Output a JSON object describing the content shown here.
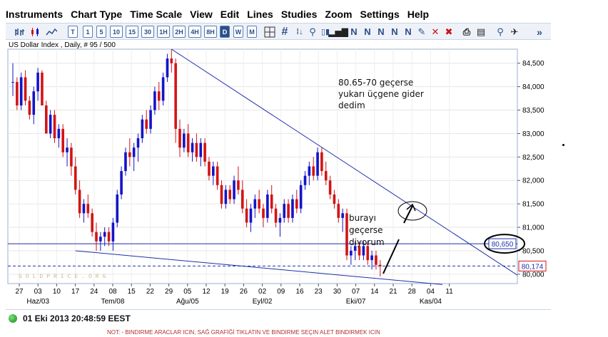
{
  "menu": [
    "Instruments",
    "Chart Type",
    "Time Scale",
    "View",
    "Edit",
    "Lines",
    "Studies",
    "Zoom",
    "Settings",
    "Help"
  ],
  "toolbar": {
    "timeframes": [
      "T",
      "1",
      "5",
      "10",
      "15",
      "30",
      "1H",
      "2H",
      "4H",
      "8H",
      "D",
      "W",
      "M"
    ],
    "active_timeframe": "D",
    "icons": [
      "bar-chart-icon",
      "candle-chart-icon",
      "line-chart-icon",
      "crosshair-icon",
      "grid-icon",
      "draw-tools-icons",
      "delete-icon",
      "print-icon",
      "zoom-icon",
      "pin-icon",
      "more-icon"
    ],
    "more_label": "»"
  },
  "chart_title": "US Dollar Index , Daily, # 95 / 500",
  "status": {
    "time": "01 Eki 2013 20:48:59 EEST"
  },
  "note": "NOT: - BINDIRME ARACLAR ICIN, SAĞ GRAFİĞİ TIKLATIN VE BINDIRME SEÇIN ALET BINDIRMEK ICIN",
  "colors": {
    "up": "#1414c8",
    "down": "#d21414",
    "trendline": "#1f2fa8",
    "accent": "#2a4f8a"
  },
  "chart_data": {
    "type": "candlestick",
    "ylim": [
      79.8,
      84.8
    ],
    "yticks": [
      "84,500",
      "84,000",
      "83,500",
      "83,000",
      "82,500",
      "82,000",
      "81,500",
      "81,000",
      "80,500",
      "80,000"
    ],
    "xticks": [
      "27",
      "03",
      "10",
      "17",
      "24",
      "08",
      "15",
      "22",
      "29",
      "05",
      "12",
      "19",
      "26",
      "02",
      "09",
      "16",
      "23",
      "30",
      "07",
      "14",
      "21",
      "28",
      "04",
      "11"
    ],
    "month_labels": [
      "Haz/03",
      "Tem/08",
      "Ağu/05",
      "Eyl/02",
      "Eki/07",
      "Kas/04"
    ],
    "horizontal_line_label": "80,650",
    "horizontal_line_value": 80.65,
    "current_price_label": "80,174",
    "current_price_value": 80.174,
    "watermark": "GOLDPRICE.ORG",
    "annotations": [
      "80.65-70 geçerse yukarı üçgene gider dedim",
      "burayı geçerse diyorum"
    ],
    "candles": [
      [
        84.1,
        84.5,
        83.8,
        84.1
      ],
      [
        84.1,
        84.2,
        83.5,
        83.6
      ],
      [
        83.6,
        84.3,
        83.5,
        84.2
      ],
      [
        84.2,
        84.35,
        83.6,
        83.7
      ],
      [
        83.7,
        83.8,
        83.3,
        83.4
      ],
      [
        83.4,
        84.0,
        83.2,
        83.9
      ],
      [
        83.9,
        84.4,
        83.7,
        84.3
      ],
      [
        84.3,
        84.35,
        83.6,
        83.6
      ],
      [
        83.6,
        83.7,
        83.0,
        83.0
      ],
      [
        83.0,
        83.5,
        82.9,
        83.4
      ],
      [
        83.4,
        83.5,
        82.8,
        82.9
      ],
      [
        82.9,
        83.2,
        82.7,
        83.1
      ],
      [
        83.1,
        83.2,
        82.5,
        82.6
      ],
      [
        82.6,
        82.9,
        82.3,
        82.7
      ],
      [
        82.7,
        82.8,
        82.1,
        82.3
      ],
      [
        82.3,
        82.5,
        81.7,
        81.8
      ],
      [
        81.8,
        82.0,
        81.2,
        81.3
      ],
      [
        81.3,
        81.6,
        81.1,
        81.5
      ],
      [
        81.5,
        81.7,
        81.2,
        81.3
      ],
      [
        81.3,
        81.4,
        80.8,
        80.9
      ],
      [
        80.9,
        81.1,
        80.5,
        80.7
      ],
      [
        80.7,
        80.9,
        80.5,
        80.8
      ],
      [
        80.8,
        81.0,
        80.6,
        80.9
      ],
      [
        80.9,
        81.0,
        80.6,
        80.7
      ],
      [
        80.7,
        81.2,
        80.5,
        81.1
      ],
      [
        81.1,
        81.8,
        81.0,
        81.7
      ],
      [
        81.7,
        82.3,
        81.6,
        82.2
      ],
      [
        82.2,
        82.7,
        82.1,
        82.6
      ],
      [
        82.6,
        82.9,
        82.3,
        82.5
      ],
      [
        82.5,
        82.8,
        82.2,
        82.7
      ],
      [
        82.7,
        83.0,
        82.4,
        82.9
      ],
      [
        82.9,
        83.4,
        82.8,
        83.3
      ],
      [
        83.3,
        83.5,
        83.0,
        83.1
      ],
      [
        83.1,
        83.6,
        83.0,
        83.5
      ],
      [
        83.5,
        84.0,
        83.4,
        83.9
      ],
      [
        83.9,
        84.1,
        83.5,
        83.7
      ],
      [
        83.7,
        84.3,
        83.6,
        84.2
      ],
      [
        84.2,
        84.7,
        84.1,
        84.6
      ],
      [
        84.6,
        84.8,
        84.3,
        84.5
      ],
      [
        84.5,
        84.6,
        82.8,
        83.1
      ],
      [
        83.1,
        83.3,
        82.5,
        82.7
      ],
      [
        82.7,
        83.1,
        82.6,
        83.0
      ],
      [
        83.0,
        83.2,
        82.5,
        82.6
      ],
      [
        82.6,
        82.9,
        82.4,
        82.8
      ],
      [
        82.8,
        83.0,
        82.4,
        82.5
      ],
      [
        82.5,
        82.9,
        82.3,
        82.8
      ],
      [
        82.8,
        82.9,
        82.3,
        82.4
      ],
      [
        82.4,
        82.5,
        82.0,
        82.1
      ],
      [
        82.1,
        82.4,
        81.9,
        82.3
      ],
      [
        82.3,
        82.4,
        81.8,
        81.9
      ],
      [
        81.9,
        82.0,
        81.4,
        81.5
      ],
      [
        81.5,
        81.9,
        81.4,
        81.8
      ],
      [
        81.8,
        81.9,
        81.5,
        81.6
      ],
      [
        81.6,
        82.1,
        81.5,
        82.0
      ],
      [
        82.0,
        82.3,
        81.7,
        81.8
      ],
      [
        81.8,
        82.0,
        81.3,
        81.4
      ],
      [
        81.4,
        81.6,
        81.0,
        81.1
      ],
      [
        81.1,
        81.5,
        80.9,
        81.4
      ],
      [
        81.4,
        81.7,
        81.2,
        81.6
      ],
      [
        81.6,
        81.8,
        81.3,
        81.4
      ],
      [
        81.4,
        81.5,
        81.0,
        81.2
      ],
      [
        81.2,
        81.8,
        81.1,
        81.7
      ],
      [
        81.7,
        81.9,
        81.3,
        81.4
      ],
      [
        81.4,
        81.5,
        81.0,
        81.1
      ],
      [
        81.1,
        81.3,
        80.8,
        81.2
      ],
      [
        81.2,
        81.6,
        81.1,
        81.5
      ],
      [
        81.5,
        81.6,
        81.1,
        81.2
      ],
      [
        81.2,
        81.7,
        81.1,
        81.6
      ],
      [
        81.6,
        81.8,
        81.3,
        81.4
      ],
      [
        81.4,
        82.0,
        81.3,
        81.9
      ],
      [
        81.9,
        82.2,
        81.8,
        82.1
      ],
      [
        82.1,
        82.4,
        81.9,
        82.3
      ],
      [
        82.3,
        82.5,
        82.0,
        82.1
      ],
      [
        82.1,
        82.7,
        82.0,
        82.6
      ],
      [
        82.6,
        82.7,
        82.1,
        82.2
      ],
      [
        82.2,
        82.4,
        81.9,
        82.0
      ],
      [
        82.0,
        82.1,
        81.6,
        81.7
      ],
      [
        81.7,
        81.8,
        81.4,
        81.5
      ],
      [
        81.5,
        81.6,
        81.1,
        81.2
      ],
      [
        81.2,
        81.4,
        80.9,
        81.3
      ],
      [
        81.3,
        81.4,
        80.3,
        80.4
      ],
      [
        80.4,
        80.6,
        80.2,
        80.5
      ],
      [
        80.5,
        80.7,
        80.3,
        80.6
      ],
      [
        80.6,
        80.7,
        80.3,
        80.4
      ],
      [
        80.4,
        80.7,
        80.3,
        80.6
      ],
      [
        80.6,
        80.7,
        80.2,
        80.3
      ],
      [
        80.3,
        80.5,
        80.1,
        80.4
      ],
      [
        80.4,
        80.5,
        80.1,
        80.2
      ],
      [
        80.2,
        80.3,
        79.95,
        80.17
      ]
    ]
  }
}
